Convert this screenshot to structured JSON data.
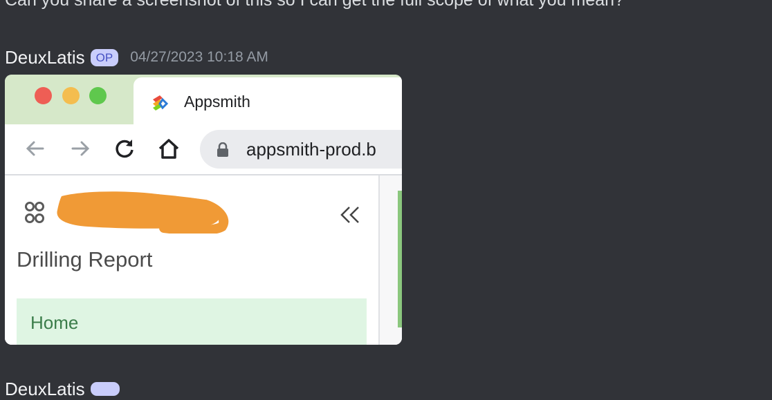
{
  "previous_message": {
    "text": "Can you share a screenshot of this so I can get the full scope of what you mean?"
  },
  "message": {
    "author": "DeuxLatis",
    "badge": "OP",
    "timestamp": "04/27/2023 10:18 AM"
  },
  "screenshot_attachment": {
    "tab_title": "Appsmith",
    "url": "appsmith-prod.b",
    "app_title": "Drilling Report",
    "menu_home": "Home",
    "redaction_color": "#f09a36",
    "nav_icons": [
      "back-arrow-icon",
      "forward-arrow-icon",
      "reload-icon",
      "home-icon"
    ]
  },
  "next_message": {
    "author": "DeuxLatis",
    "timestamp": ""
  }
}
